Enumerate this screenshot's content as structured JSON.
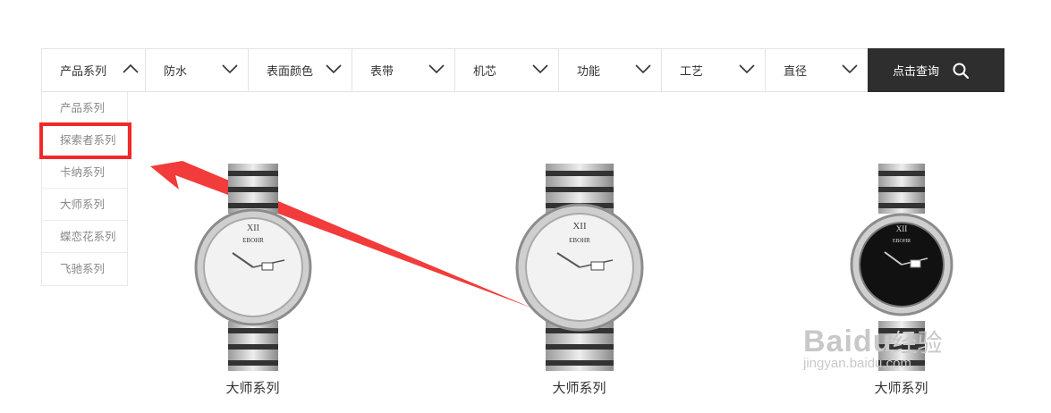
{
  "filter_bar": {
    "filters": [
      {
        "label": "产品系列",
        "expanded": true
      },
      {
        "label": "防水",
        "expanded": false
      },
      {
        "label": "表面颜色",
        "expanded": false
      },
      {
        "label": "表带",
        "expanded": false
      },
      {
        "label": "机芯",
        "expanded": false
      },
      {
        "label": "功能",
        "expanded": false
      },
      {
        "label": "工艺",
        "expanded": false
      },
      {
        "label": "直径",
        "expanded": false
      }
    ],
    "query_button": {
      "label": "点击查询",
      "icon": "search-icon"
    }
  },
  "dropdown": {
    "items": [
      "产品系列",
      "探索者系列",
      "卡纳系列",
      "大师系列",
      "蝶恋花系列",
      "飞驰系列"
    ],
    "highlighted_index": 1,
    "highlight_color": "#f02a2a"
  },
  "products": [
    {
      "name": "大师系列",
      "dial_color": "#f2f2f2",
      "brand": "EBOHR"
    },
    {
      "name": "大师系列",
      "dial_color": "#f2f2f2",
      "brand": "EBOHR"
    },
    {
      "name": "大师系列",
      "dial_color": "#111111",
      "brand": "EBOHR"
    }
  ],
  "watermark": {
    "logo_latin": "Bai",
    "logo_mid": "du",
    "logo_cn": "经验",
    "url": "jingyan.baidu.com"
  },
  "colors": {
    "accent_dark": "#2e2e2e",
    "annotation_red": "#f02a2a",
    "border": "#e3e3e3"
  }
}
